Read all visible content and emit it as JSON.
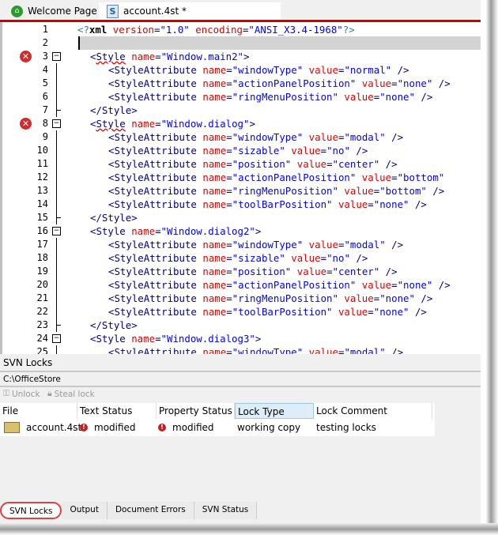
{
  "tabs": [
    {
      "label": "Welcome Page",
      "icon": "home-icon"
    },
    {
      "label": "account.4st *",
      "icon": "s-file-icon",
      "active": true
    }
  ],
  "editor": {
    "lines": [
      {
        "n": "1",
        "indent": 0,
        "segs": [
          [
            "pi",
            "<?"
          ],
          [
            "xml",
            "xml"
          ],
          [
            "t",
            " "
          ],
          [
            "attr",
            "version"
          ],
          [
            "tag",
            "="
          ],
          [
            "val",
            "\"1.0\""
          ],
          [
            "t",
            " "
          ],
          [
            "attr",
            "encoding"
          ],
          [
            "tag",
            "="
          ],
          [
            "val",
            "\"ANSI_X3.4-1968\""
          ],
          [
            "pi",
            "?>"
          ]
        ]
      },
      {
        "n": "2",
        "indent": 0,
        "current": true,
        "segs": []
      },
      {
        "n": "3",
        "indent": 1,
        "error": true,
        "fold": true,
        "segs": [
          [
            "tag",
            "<"
          ],
          [
            "sq",
            "Style"
          ],
          [
            "t",
            " "
          ],
          [
            "attr",
            "name"
          ],
          [
            "tag",
            "="
          ],
          [
            "val",
            "\"Window.main2\""
          ],
          [
            "tag",
            ">"
          ]
        ]
      },
      {
        "n": "4",
        "indent": 2,
        "segs": [
          [
            "tag",
            "<StyleAttribute "
          ],
          [
            "attr",
            "name"
          ],
          [
            "tag",
            "="
          ],
          [
            "val",
            "\"windowType\""
          ],
          [
            "t",
            " "
          ],
          [
            "attr",
            "value"
          ],
          [
            "tag",
            "="
          ],
          [
            "val",
            "\"normal\""
          ],
          [
            "tag",
            " />"
          ]
        ]
      },
      {
        "n": "5",
        "indent": 2,
        "segs": [
          [
            "tag",
            "<StyleAttribute "
          ],
          [
            "attr",
            "name"
          ],
          [
            "tag",
            "="
          ],
          [
            "val",
            "\"actionPanelPosition\""
          ],
          [
            "t",
            " "
          ],
          [
            "attr",
            "value"
          ],
          [
            "tag",
            "="
          ],
          [
            "val",
            "\"none\""
          ],
          [
            "tag",
            " />"
          ]
        ]
      },
      {
        "n": "6",
        "indent": 2,
        "segs": [
          [
            "tag",
            "<StyleAttribute "
          ],
          [
            "attr",
            "name"
          ],
          [
            "tag",
            "="
          ],
          [
            "val",
            "\"ringMenuPosition\""
          ],
          [
            "t",
            " "
          ],
          [
            "attr",
            "value"
          ],
          [
            "tag",
            "="
          ],
          [
            "val",
            "\"none\""
          ],
          [
            "tag",
            " />"
          ]
        ]
      },
      {
        "n": "7",
        "indent": 1,
        "segs": [
          [
            "tag",
            "</Style>"
          ]
        ]
      },
      {
        "n": "8",
        "indent": 1,
        "error": true,
        "fold": true,
        "segs": [
          [
            "tag",
            "<"
          ],
          [
            "sq",
            "Style"
          ],
          [
            "t",
            " "
          ],
          [
            "attr",
            "name"
          ],
          [
            "tag",
            "="
          ],
          [
            "val",
            "\"Window.dialog\""
          ],
          [
            "tag",
            ">"
          ]
        ]
      },
      {
        "n": "9",
        "indent": 2,
        "segs": [
          [
            "tag",
            "<StyleAttribute "
          ],
          [
            "attr",
            "name"
          ],
          [
            "tag",
            "="
          ],
          [
            "val",
            "\"windowType\""
          ],
          [
            "t",
            " "
          ],
          [
            "attr",
            "value"
          ],
          [
            "tag",
            "="
          ],
          [
            "val",
            "\"modal\""
          ],
          [
            "tag",
            " />"
          ]
        ]
      },
      {
        "n": "10",
        "indent": 2,
        "segs": [
          [
            "tag",
            "<StyleAttribute "
          ],
          [
            "attr",
            "name"
          ],
          [
            "tag",
            "="
          ],
          [
            "val",
            "\"sizable\""
          ],
          [
            "t",
            " "
          ],
          [
            "attr",
            "value"
          ],
          [
            "tag",
            "="
          ],
          [
            "val",
            "\"no\""
          ],
          [
            "tag",
            " />"
          ]
        ]
      },
      {
        "n": "11",
        "indent": 2,
        "segs": [
          [
            "tag",
            "<StyleAttribute "
          ],
          [
            "attr",
            "name"
          ],
          [
            "tag",
            "="
          ],
          [
            "val",
            "\"position\""
          ],
          [
            "t",
            " "
          ],
          [
            "attr",
            "value"
          ],
          [
            "tag",
            "="
          ],
          [
            "val",
            "\"center\""
          ],
          [
            "tag",
            " />"
          ]
        ]
      },
      {
        "n": "12",
        "indent": 2,
        "segs": [
          [
            "tag",
            "<StyleAttribute "
          ],
          [
            "attr",
            "name"
          ],
          [
            "tag",
            "="
          ],
          [
            "val",
            "\"actionPanelPosition\""
          ],
          [
            "t",
            " "
          ],
          [
            "attr",
            "value"
          ],
          [
            "tag",
            "="
          ],
          [
            "val",
            "\"bottom\""
          ]
        ]
      },
      {
        "n": "13",
        "indent": 2,
        "segs": [
          [
            "tag",
            "<StyleAttribute "
          ],
          [
            "attr",
            "name"
          ],
          [
            "tag",
            "="
          ],
          [
            "val",
            "\"ringMenuPosition\""
          ],
          [
            "t",
            " "
          ],
          [
            "attr",
            "value"
          ],
          [
            "tag",
            "="
          ],
          [
            "val",
            "\"bottom\""
          ],
          [
            "tag",
            " />"
          ]
        ]
      },
      {
        "n": "14",
        "indent": 2,
        "segs": [
          [
            "tag",
            "<StyleAttribute "
          ],
          [
            "attr",
            "name"
          ],
          [
            "tag",
            "="
          ],
          [
            "val",
            "\"toolBarPosition\""
          ],
          [
            "t",
            " "
          ],
          [
            "attr",
            "value"
          ],
          [
            "tag",
            "="
          ],
          [
            "val",
            "\"none\""
          ],
          [
            "tag",
            " />"
          ]
        ]
      },
      {
        "n": "15",
        "indent": 1,
        "segs": [
          [
            "tag",
            "</Style>"
          ]
        ]
      },
      {
        "n": "16",
        "indent": 1,
        "fold": true,
        "segs": [
          [
            "tag",
            "<Style "
          ],
          [
            "attr",
            "name"
          ],
          [
            "tag",
            "="
          ],
          [
            "val",
            "\"Window.dialog2\""
          ],
          [
            "tag",
            ">"
          ]
        ]
      },
      {
        "n": "17",
        "indent": 2,
        "segs": [
          [
            "tag",
            "<StyleAttribute "
          ],
          [
            "attr",
            "name"
          ],
          [
            "tag",
            "="
          ],
          [
            "val",
            "\"windowType\""
          ],
          [
            "t",
            " "
          ],
          [
            "attr",
            "value"
          ],
          [
            "tag",
            "="
          ],
          [
            "val",
            "\"modal\""
          ],
          [
            "tag",
            " />"
          ]
        ]
      },
      {
        "n": "18",
        "indent": 2,
        "segs": [
          [
            "tag",
            "<StyleAttribute "
          ],
          [
            "attr",
            "name"
          ],
          [
            "tag",
            "="
          ],
          [
            "val",
            "\"sizable\""
          ],
          [
            "t",
            " "
          ],
          [
            "attr",
            "value"
          ],
          [
            "tag",
            "="
          ],
          [
            "val",
            "\"no\""
          ],
          [
            "tag",
            " />"
          ]
        ]
      },
      {
        "n": "19",
        "indent": 2,
        "segs": [
          [
            "tag",
            "<StyleAttribute "
          ],
          [
            "attr",
            "name"
          ],
          [
            "tag",
            "="
          ],
          [
            "val",
            "\"position\""
          ],
          [
            "t",
            " "
          ],
          [
            "attr",
            "value"
          ],
          [
            "tag",
            "="
          ],
          [
            "val",
            "\"center\""
          ],
          [
            "tag",
            " />"
          ]
        ]
      },
      {
        "n": "20",
        "indent": 2,
        "segs": [
          [
            "tag",
            "<StyleAttribute "
          ],
          [
            "attr",
            "name"
          ],
          [
            "tag",
            "="
          ],
          [
            "val",
            "\"actionPanelPosition\""
          ],
          [
            "t",
            " "
          ],
          [
            "attr",
            "value"
          ],
          [
            "tag",
            "="
          ],
          [
            "val",
            "\"none\""
          ],
          [
            "tag",
            " />"
          ]
        ]
      },
      {
        "n": "21",
        "indent": 2,
        "segs": [
          [
            "tag",
            "<StyleAttribute "
          ],
          [
            "attr",
            "name"
          ],
          [
            "tag",
            "="
          ],
          [
            "val",
            "\"ringMenuPosition\""
          ],
          [
            "t",
            " "
          ],
          [
            "attr",
            "value"
          ],
          [
            "tag",
            "="
          ],
          [
            "val",
            "\"none\""
          ],
          [
            "tag",
            " />"
          ]
        ]
      },
      {
        "n": "22",
        "indent": 2,
        "segs": [
          [
            "tag",
            "<StyleAttribute "
          ],
          [
            "attr",
            "name"
          ],
          [
            "tag",
            "="
          ],
          [
            "val",
            "\"toolBarPosition\""
          ],
          [
            "t",
            " "
          ],
          [
            "attr",
            "value"
          ],
          [
            "tag",
            "="
          ],
          [
            "val",
            "\"none\""
          ],
          [
            "tag",
            " />"
          ]
        ]
      },
      {
        "n": "23",
        "indent": 1,
        "segs": [
          [
            "tag",
            "</Style>"
          ]
        ]
      },
      {
        "n": "24",
        "indent": 1,
        "fold": true,
        "segs": [
          [
            "tag",
            "<Style "
          ],
          [
            "attr",
            "name"
          ],
          [
            "tag",
            "="
          ],
          [
            "val",
            "\"Window.dialog3\""
          ],
          [
            "tag",
            ">"
          ]
        ]
      },
      {
        "n": "25",
        "indent": 2,
        "segs": [
          [
            "tag",
            "<StyleAttribute "
          ],
          [
            "attr",
            "name"
          ],
          [
            "tag",
            "="
          ],
          [
            "val",
            "\"windowType\""
          ],
          [
            "t",
            " "
          ],
          [
            "attr",
            "value"
          ],
          [
            "tag",
            "="
          ],
          [
            "val",
            "\"modal\""
          ],
          [
            "tag",
            " />"
          ]
        ]
      }
    ]
  },
  "panel": {
    "title": "SVN Locks",
    "path": "C:\\OfficeStore",
    "toolbar": {
      "unlock": "Unlock",
      "steal": "Steal lock"
    },
    "columns": [
      "File",
      "Text Status",
      "Property Status",
      "Lock Type",
      "Lock Comment"
    ],
    "rows": [
      {
        "file": "account.4st",
        "text_status": "modified",
        "property_status": "modified",
        "lock_type": "working copy",
        "lock_comment": "testing locks"
      }
    ]
  },
  "bottom_tabs": [
    "SVN Locks",
    "Output",
    "Document Errors",
    "SVN Status"
  ]
}
